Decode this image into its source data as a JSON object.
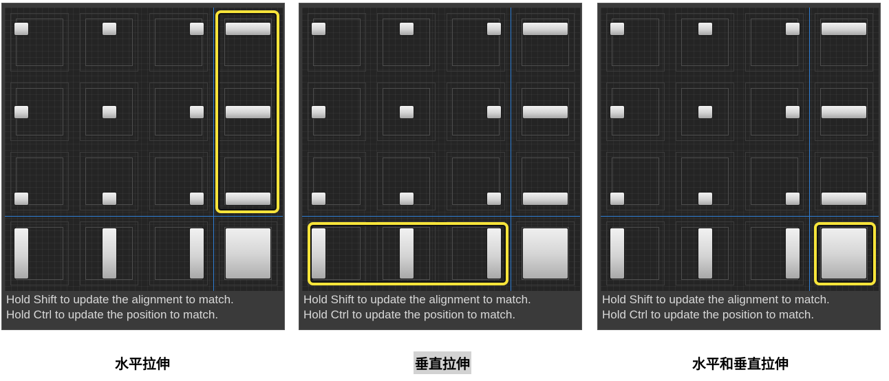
{
  "panels": [
    {
      "hint_line1": "Hold Shift to update the alignment to match.",
      "hint_line2": "Hold Ctrl to update the position to match.",
      "caption": "水平拉伸",
      "highlight": "right-column"
    },
    {
      "hint_line1": "Hold Shift to update the alignment to match.",
      "hint_line2": "Hold Ctrl to update the position to match.",
      "caption": "垂直拉伸",
      "highlight": "bottom-row"
    },
    {
      "hint_line1": "Hold Shift to update the alignment to match.",
      "hint_line2": "Hold Ctrl to update the position to match.",
      "caption": "水平和垂直拉伸",
      "highlight": "bottom-right"
    }
  ],
  "colors": {
    "highlight": "#f7e43a",
    "guide_line": "#2f7fd6",
    "panel_bg": "#242424"
  }
}
